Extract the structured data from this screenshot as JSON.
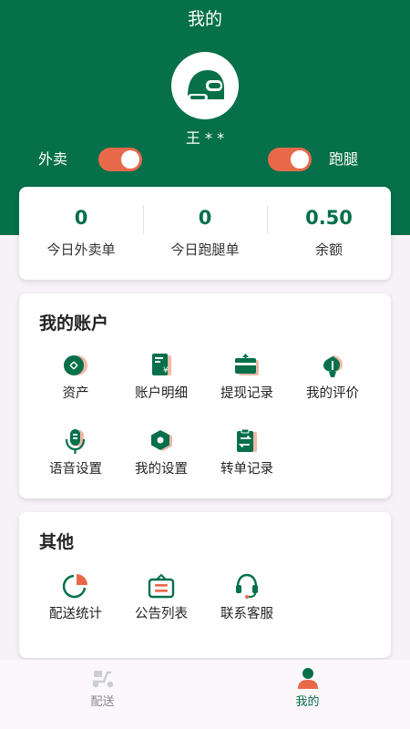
{
  "header": {
    "title": "我的",
    "username": "王 * *",
    "toggle_left_label": "外卖",
    "toggle_right_label": "跑腿",
    "toggle_left_on": true,
    "toggle_right_on": true
  },
  "stats": [
    {
      "value": "0",
      "label": "今日外卖单"
    },
    {
      "value": "0",
      "label": "今日跑腿单"
    },
    {
      "value": "0.50",
      "label": "余额"
    }
  ],
  "account": {
    "title": "我的账户",
    "items": [
      {
        "label": "资产",
        "icon": "wallet-icon"
      },
      {
        "label": "账户明细",
        "icon": "receipt-icon"
      },
      {
        "label": "提现记录",
        "icon": "withdraw-card-icon"
      },
      {
        "label": "我的评价",
        "icon": "flower-icon"
      },
      {
        "label": "语音设置",
        "icon": "microphone-icon"
      },
      {
        "label": "我的设置",
        "icon": "settings-hexagon-icon"
      },
      {
        "label": "转单记录",
        "icon": "transfer-clipboard-icon"
      }
    ]
  },
  "others": {
    "title": "其他",
    "items": [
      {
        "label": "配送统计",
        "icon": "pie-chart-icon"
      },
      {
        "label": "公告列表",
        "icon": "bulletin-board-icon"
      },
      {
        "label": "联系客服",
        "icon": "headset-icon"
      }
    ]
  },
  "tabbar": {
    "tabs": [
      {
        "label": "配送",
        "icon": "scooter-icon",
        "active": false
      },
      {
        "label": "我的",
        "icon": "person-icon",
        "active": true
      }
    ]
  },
  "colors": {
    "primary": "#05704a",
    "accent": "#e8694a",
    "background": "#f6f2f7"
  }
}
